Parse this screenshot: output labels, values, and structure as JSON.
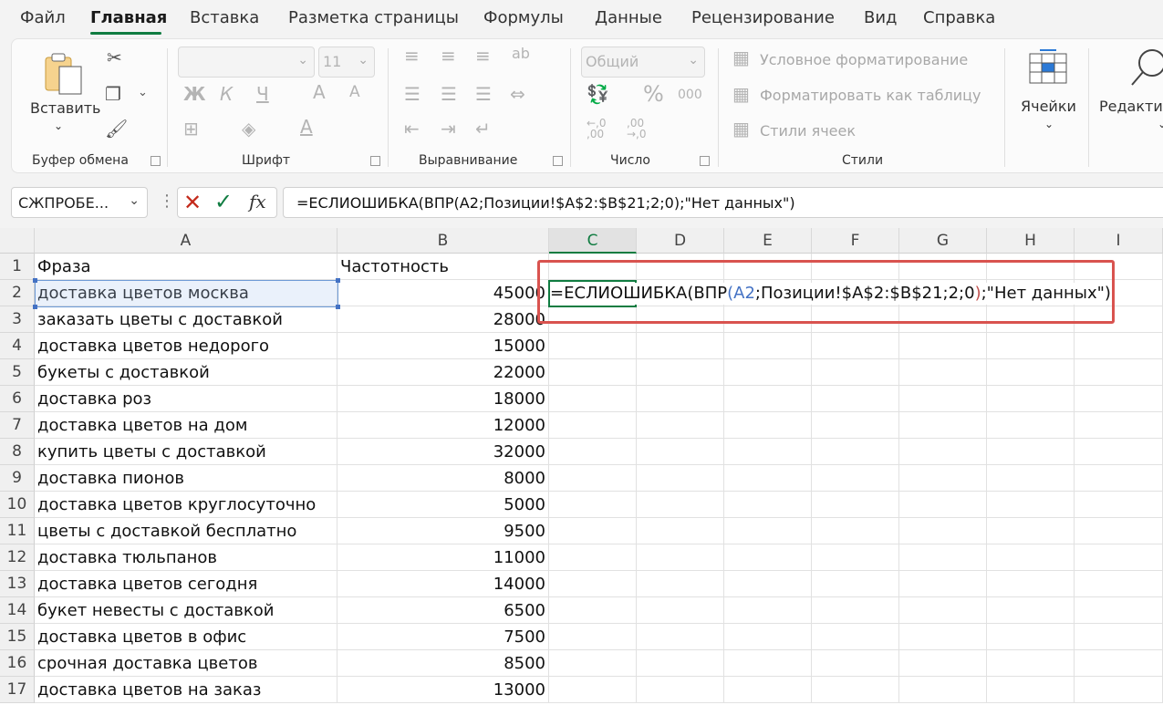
{
  "menu": {
    "items": [
      "Файл",
      "Главная",
      "Вставка",
      "Разметка страницы",
      "Формулы",
      "Данные",
      "Рецензирование",
      "Вид",
      "Справка"
    ],
    "active": "Главная"
  },
  "ribbon": {
    "clipboard": {
      "paste_label": "Вставить",
      "group_label": "Буфер обмена"
    },
    "font": {
      "size_value": "11",
      "font_value": "",
      "group_label": "Шрифт",
      "bold": "Ж",
      "italic": "К",
      "underline": "Ч",
      "grow": "A",
      "shrink": "A",
      "color_letter": "A"
    },
    "alignment": {
      "group_label": "Выравнивание"
    },
    "number": {
      "format_value": "Общий",
      "percent": "%",
      "thousands": "000",
      "inc_decimals": "←,0\n,00",
      "dec_decimals": ",00\n→,0",
      "group_label": "Число"
    },
    "styles": {
      "conditional": "Условное форматирование",
      "format_table": "Форматировать как таблицу",
      "cell_styles": "Стили ячеек",
      "group_label": "Стили"
    },
    "cells": {
      "label": "Ячейки"
    },
    "editing": {
      "label": "Редактир"
    }
  },
  "formula_bar": {
    "name_box": "СЖПРОБЕ...",
    "fx": "fx",
    "formula": "=ЕСЛИОШИБКА(ВПР(A2;Позиции!$A$2:$B$21;2;0);\"Нет данных\")"
  },
  "grid": {
    "columns": [
      "A",
      "B",
      "C",
      "D",
      "E",
      "F",
      "G",
      "H",
      "I"
    ],
    "selected_column": "C",
    "header_row": {
      "a": "Фраза",
      "b": "Частотность"
    },
    "rows": [
      {
        "n": "1",
        "a": "Фраза",
        "b": "Частотность"
      },
      {
        "n": "2",
        "a": "доставка цветов москва",
        "b": "45000"
      },
      {
        "n": "3",
        "a": "заказать цветы с доставкой",
        "b": "28000"
      },
      {
        "n": "4",
        "a": "доставка цветов недорого",
        "b": "15000"
      },
      {
        "n": "5",
        "a": "букеты с доставкой",
        "b": "22000"
      },
      {
        "n": "6",
        "a": "доставка роз",
        "b": "18000"
      },
      {
        "n": "7",
        "a": "доставка цветов на дом",
        "b": "12000"
      },
      {
        "n": "8",
        "a": "купить цветы с доставкой",
        "b": "32000"
      },
      {
        "n": "9",
        "a": "доставка пионов",
        "b": "8000"
      },
      {
        "n": "10",
        "a": "доставка цветов круглосуточно",
        "b": "5000"
      },
      {
        "n": "11",
        "a": "цветы с доставкой бесплатно",
        "b": "9500"
      },
      {
        "n": "12",
        "a": "доставка тюльпанов",
        "b": "11000"
      },
      {
        "n": "13",
        "a": "доставка цветов сегодня",
        "b": "14000"
      },
      {
        "n": "14",
        "a": "букет невесты с доставкой",
        "b": "6500"
      },
      {
        "n": "15",
        "a": "доставка цветов в офис",
        "b": "7500"
      },
      {
        "n": "16",
        "a": "срочная доставка цветов",
        "b": "8500"
      },
      {
        "n": "17",
        "a": "доставка цветов на заказ",
        "b": "13000"
      }
    ],
    "editing_cell": {
      "prefix": "=ЕСЛИОШИБКА(ВПР",
      "open": "(",
      "ref": "A2",
      "middle": ";Позиции!$A$2:$B$21;2;0",
      "close": ")",
      "suffix": ";\"Нет данных\")"
    }
  }
}
